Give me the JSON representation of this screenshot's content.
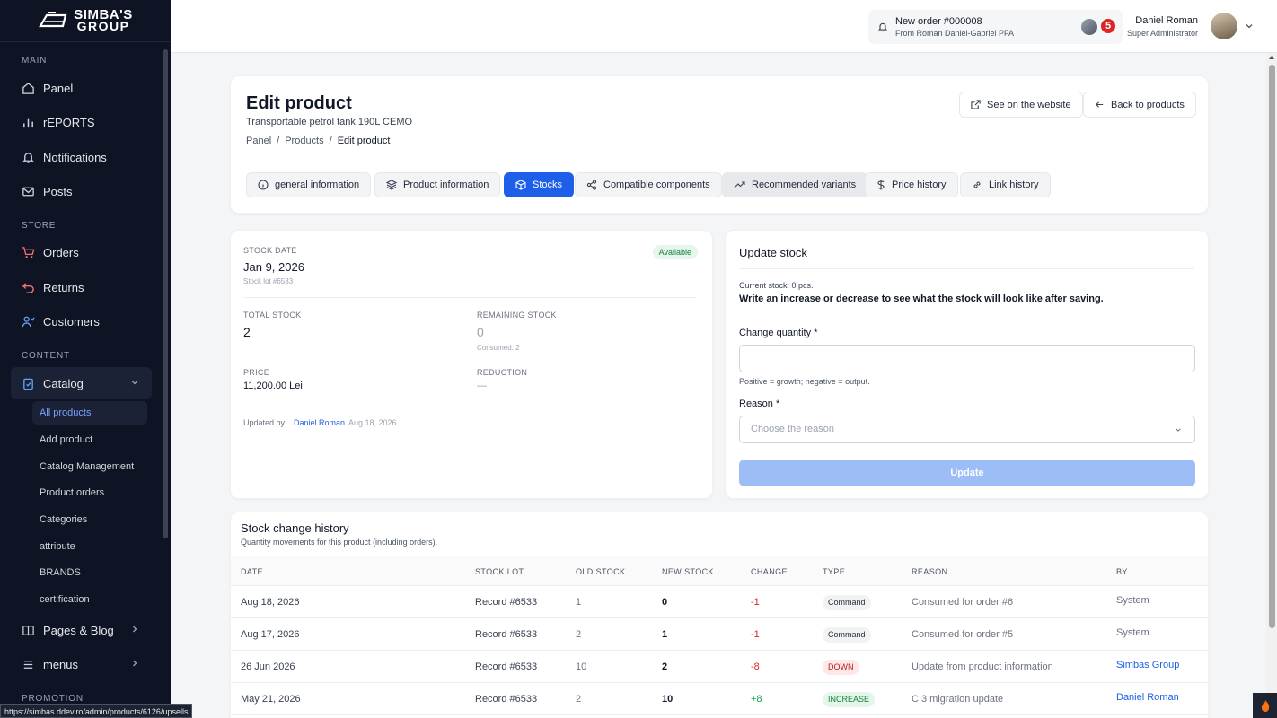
{
  "brand": {
    "line1": "SIMBA'S",
    "line2": "GROUP"
  },
  "sidebar": {
    "sections": {
      "main": "MAIN",
      "store": "STORE",
      "content": "CONTENT",
      "promotion": "PROMOTION"
    },
    "items": {
      "panel": "Panel",
      "reports": "rEPORTS",
      "notifications": "Notifications",
      "posts": "Posts",
      "orders": "Orders",
      "returns": "Returns",
      "customers": "Customers",
      "catalog": "Catalog",
      "pages_blog": "Pages & Blog",
      "menus": "menus"
    },
    "catalog_sub": [
      "All products",
      "Add product",
      "Catalog Management",
      "Product orders",
      "Categories",
      "attribute",
      "BRANDS",
      "certification"
    ]
  },
  "status_url": "https://simbas.ddev.ro/admin/products/6126/upsells",
  "topbar": {
    "notif_title": "New order #000008",
    "notif_from": "From Roman Daniel-Gabriel PFA",
    "badge_count": "5",
    "user_name": "Daniel Roman",
    "user_role": "Super Administrator"
  },
  "header": {
    "title": "Edit product",
    "subtitle": "Transportable petrol tank 190L CEMO",
    "breadcrumb": [
      "Panel",
      "Products",
      "Edit product"
    ],
    "sep": "/",
    "see_website": "See on the website",
    "back": "Back to products",
    "tabs": [
      "general information",
      "Product information",
      "Stocks",
      "Compatible components",
      "Recommended variants",
      "Price history",
      "Link history"
    ]
  },
  "stock": {
    "date_label": "STOCK DATE",
    "date": "Jan 9, 2026",
    "lot": "Stock lot #6533",
    "status": "Available",
    "total_label": "TOTAL STOCK",
    "total": "2",
    "remaining_label": "REMAINING STOCK",
    "remaining": "0",
    "consumed": "Consumed: 2",
    "price_label": "PRICE",
    "price": "11,200.00 Lei",
    "reduction_label": "REDUCTION",
    "reduction": "—",
    "updated_by_label": "Updated by:",
    "updated_by": "Daniel Roman",
    "updated_at": "Aug 18, 2026"
  },
  "update": {
    "title": "Update stock",
    "current": "Current stock: 0 pcs.",
    "hint": "Write an increase or decrease to see what the stock will look like after saving.",
    "qty_label": "Change quantity *",
    "qty_value": "",
    "qty_help": "Positive = growth; negative = output.",
    "reason_label": "Reason *",
    "reason_placeholder": "Choose the reason",
    "button": "Update"
  },
  "history": {
    "title": "Stock change history",
    "subtitle": "Quantity movements for this product (including orders).",
    "columns": [
      "DATE",
      "STOCK LOT",
      "OLD STOCK",
      "NEW STOCK",
      "CHANGE",
      "TYPE",
      "REASON",
      "BY"
    ],
    "rows": [
      {
        "date": "Aug 18, 2026",
        "lot": "Record #6533",
        "old": "1",
        "new": "0",
        "change": "-1",
        "type": "Command",
        "reason": "Consumed for order #6",
        "by": "System"
      },
      {
        "date": "Aug 17, 2026",
        "lot": "Record #6533",
        "old": "2",
        "new": "1",
        "change": "-1",
        "type": "Command",
        "reason": "Consumed for order #5",
        "by": "System"
      },
      {
        "date": "26 Jun 2026",
        "lot": "Record #6533",
        "old": "10",
        "new": "2",
        "change": "-8",
        "type": "DOWN",
        "reason": "Update from product information",
        "by": "Simbas Group"
      },
      {
        "date": "May 21, 2026",
        "lot": "Record #6533",
        "old": "2",
        "new": "10",
        "change": "+8",
        "type": "INCREASE",
        "reason": "CI3 migration update",
        "by": "Daniel Roman"
      }
    ]
  },
  "colors": {
    "primary": "#1d5fe8",
    "sidebar_bg": "#0f1424",
    "danger": "#dc2626",
    "success": "#16a34a"
  }
}
